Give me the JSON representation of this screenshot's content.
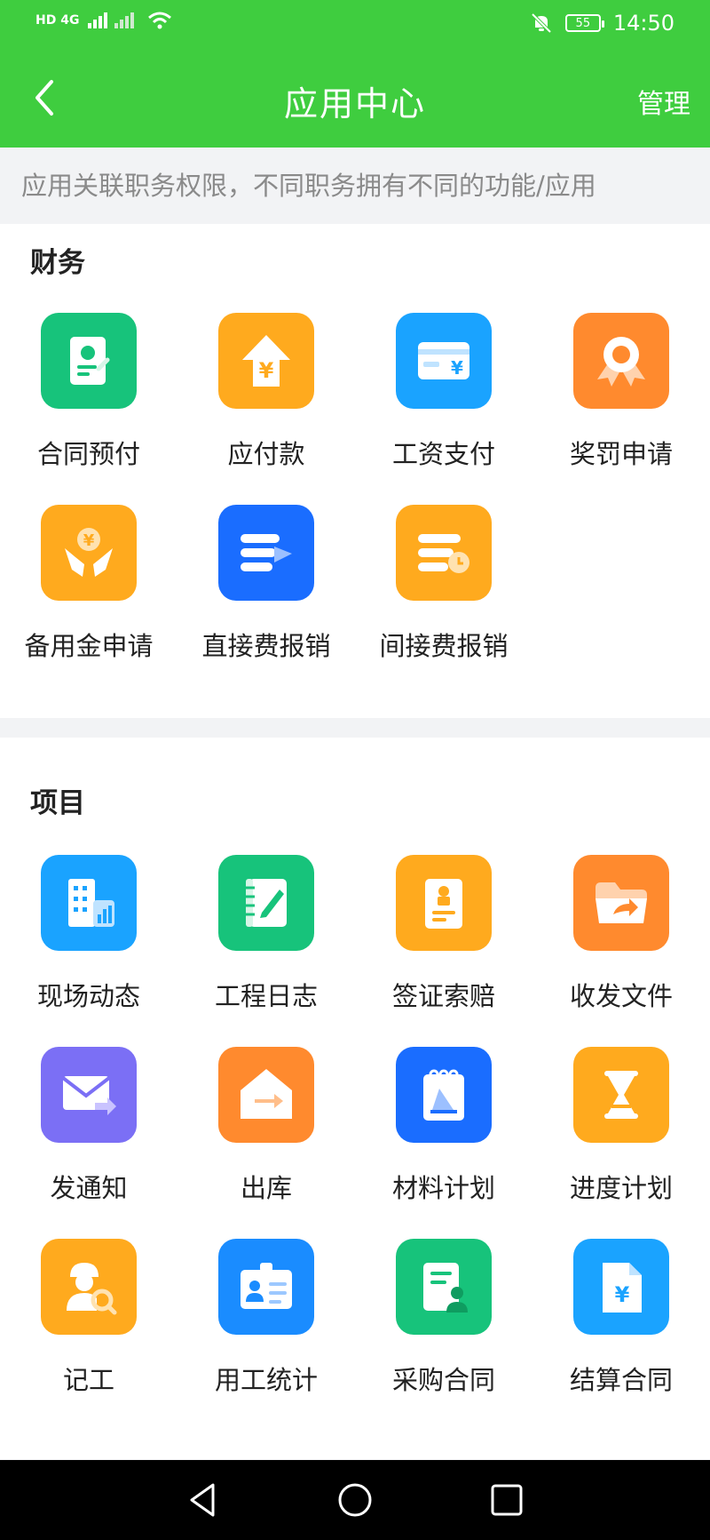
{
  "status": {
    "network": "HD 4G",
    "battery": "55",
    "time": "14:50"
  },
  "header": {
    "title": "应用中心",
    "manage": "管理"
  },
  "notice": "应用关联职务权限，不同职务拥有不同的功能/应用",
  "finance": {
    "title": "财务",
    "apps": [
      {
        "label": "合同预付",
        "icon": "contract-prepay-icon",
        "color": "#17c37b"
      },
      {
        "label": "应付款",
        "icon": "payable-icon",
        "color": "#ffaa1e"
      },
      {
        "label": "工资支付",
        "icon": "salary-card-icon",
        "color": "#1aa3ff"
      },
      {
        "label": "奖罚申请",
        "icon": "award-icon",
        "color": "#ff8a2e"
      },
      {
        "label": "备用金申请",
        "icon": "petty-cash-icon",
        "color": "#ffaa1e"
      },
      {
        "label": "直接费报销",
        "icon": "direct-reimburse-icon",
        "color": "#1a6dff"
      },
      {
        "label": "间接费报销",
        "icon": "indirect-reimburse-icon",
        "color": "#ffaa1e"
      }
    ]
  },
  "project": {
    "title": "项目",
    "apps": [
      {
        "label": "现场动态",
        "icon": "building-stats-icon",
        "color": "#1aa3ff"
      },
      {
        "label": "工程日志",
        "icon": "notebook-icon",
        "color": "#17c37b"
      },
      {
        "label": "签证索赔",
        "icon": "stamp-doc-icon",
        "color": "#ffaa1e"
      },
      {
        "label": "收发文件",
        "icon": "folder-share-icon",
        "color": "#ff8a2e"
      },
      {
        "label": "发通知",
        "icon": "mail-send-icon",
        "color": "#7b6ff5"
      },
      {
        "label": "出库",
        "icon": "warehouse-out-icon",
        "color": "#ff8a2e"
      },
      {
        "label": "材料计划",
        "icon": "material-plan-icon",
        "color": "#1a6dff"
      },
      {
        "label": "进度计划",
        "icon": "hourglass-icon",
        "color": "#ffaa1e"
      },
      {
        "label": "记工",
        "icon": "worker-search-icon",
        "color": "#ffaa1e"
      },
      {
        "label": "用工统计",
        "icon": "id-card-icon",
        "color": "#1a8cff"
      },
      {
        "label": "采购合同",
        "icon": "purchase-contract-icon",
        "color": "#17c37b"
      },
      {
        "label": "结算合同",
        "icon": "settlement-doc-icon",
        "color": "#1aa3ff"
      }
    ]
  }
}
